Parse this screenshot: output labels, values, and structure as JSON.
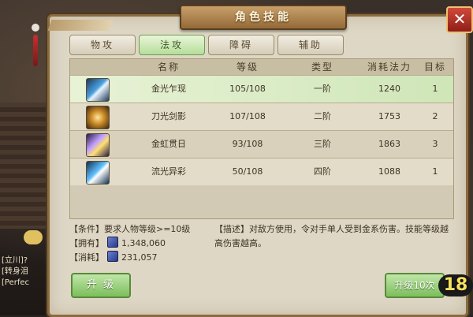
{
  "window": {
    "title": "角色技能",
    "close_glyph": "✕"
  },
  "tabs": [
    {
      "label": "物攻",
      "active": false
    },
    {
      "label": "法攻",
      "active": true
    },
    {
      "label": "障碍",
      "active": false
    },
    {
      "label": "辅助",
      "active": false
    }
  ],
  "table": {
    "headers": [
      "名称",
      "等级",
      "类型",
      "消耗法力",
      "目标"
    ],
    "rows": [
      {
        "icon": "blade-light-icon",
        "name": "金光乍现",
        "level": "105/108",
        "type": "一阶",
        "mana": "1240",
        "target": "1",
        "selected": true
      },
      {
        "icon": "sword-shadow-icon",
        "name": "刀光剑影",
        "level": "107/108",
        "type": "二阶",
        "mana": "1753",
        "target": "2",
        "selected": false
      },
      {
        "icon": "rainbow-sun-icon",
        "name": "金虹贯日",
        "level": "93/108",
        "type": "三阶",
        "mana": "1863",
        "target": "3",
        "selected": false
      },
      {
        "icon": "flowing-light-icon",
        "name": "流光异彩",
        "level": "50/108",
        "type": "四阶",
        "mana": "1088",
        "target": "1",
        "selected": false
      }
    ]
  },
  "info": {
    "condition": "【条件】要求人物等级>=10级",
    "own_label": "【拥有】",
    "own_value": "1,348,060",
    "cost_label": "【消耗】",
    "cost_value": "231,057",
    "description": "【描述】对敌方使用，令对手单人受到金系伤害。技能等级越高伤害越高。"
  },
  "buttons": {
    "upgrade": "升 级",
    "upgrade10": "升级10次"
  },
  "badge": "18",
  "chat": {
    "lines": [
      "[立川]?",
      "[转身泪",
      "[Perfec"
    ]
  },
  "colors": {
    "active_tab": "#b6dd9a",
    "panel_bg": "#ded7c5",
    "frame": "#8a6a3e",
    "close": "#d04a3a"
  }
}
